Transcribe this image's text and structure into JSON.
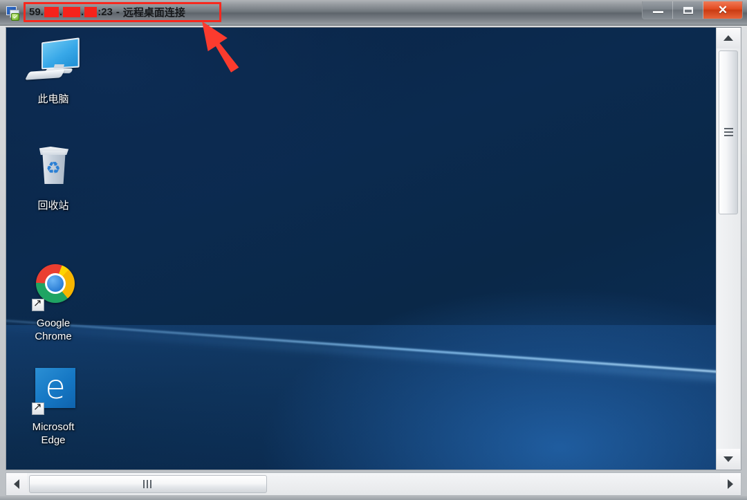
{
  "window": {
    "title_prefix": "59.",
    "title_dot1": ".",
    "title_dot2": ".",
    "title_port": ":23",
    "title_separator": "-",
    "title_app": "远程桌面连接",
    "system_icon": "remote-desktop-icon",
    "redaction_color": "#f5231b",
    "highlight_color": "#f8281e",
    "titlebar_color": "#6e757b",
    "caption": {
      "minimize_label": "",
      "restore_label": "",
      "close_label": "✕",
      "close_color": "#d8421a"
    }
  },
  "desktop": {
    "background_color": "#0b2a4f",
    "accent_color": "#5aa5eb",
    "icons": [
      {
        "label": "此电脑",
        "icon": "this-pc-icon",
        "shortcut": false
      },
      {
        "label": "回收站",
        "icon": "recycle-bin-icon",
        "shortcut": false,
        "glyph": "♻"
      },
      {
        "label_line1": "Google",
        "label_line2": "Chrome",
        "icon": "google-chrome-icon",
        "shortcut": true
      },
      {
        "label_line1": "Microsoft",
        "label_line2": "Edge",
        "icon": "microsoft-edge-icon",
        "shortcut": true,
        "glyph": "e"
      }
    ]
  },
  "scrollbars": {
    "vertical": {
      "up_arrow": "scroll-up-arrow",
      "down_arrow": "scroll-down-arrow",
      "thumb": "vertical-scroll-thumb"
    },
    "horizontal": {
      "left_arrow": "scroll-left-arrow",
      "right_arrow": "scroll-right-arrow",
      "thumb": "horizontal-scroll-thumb"
    }
  },
  "annotation": {
    "arrow_color": "#fb3b2e",
    "arrow_target": "title-bar-highlight"
  }
}
